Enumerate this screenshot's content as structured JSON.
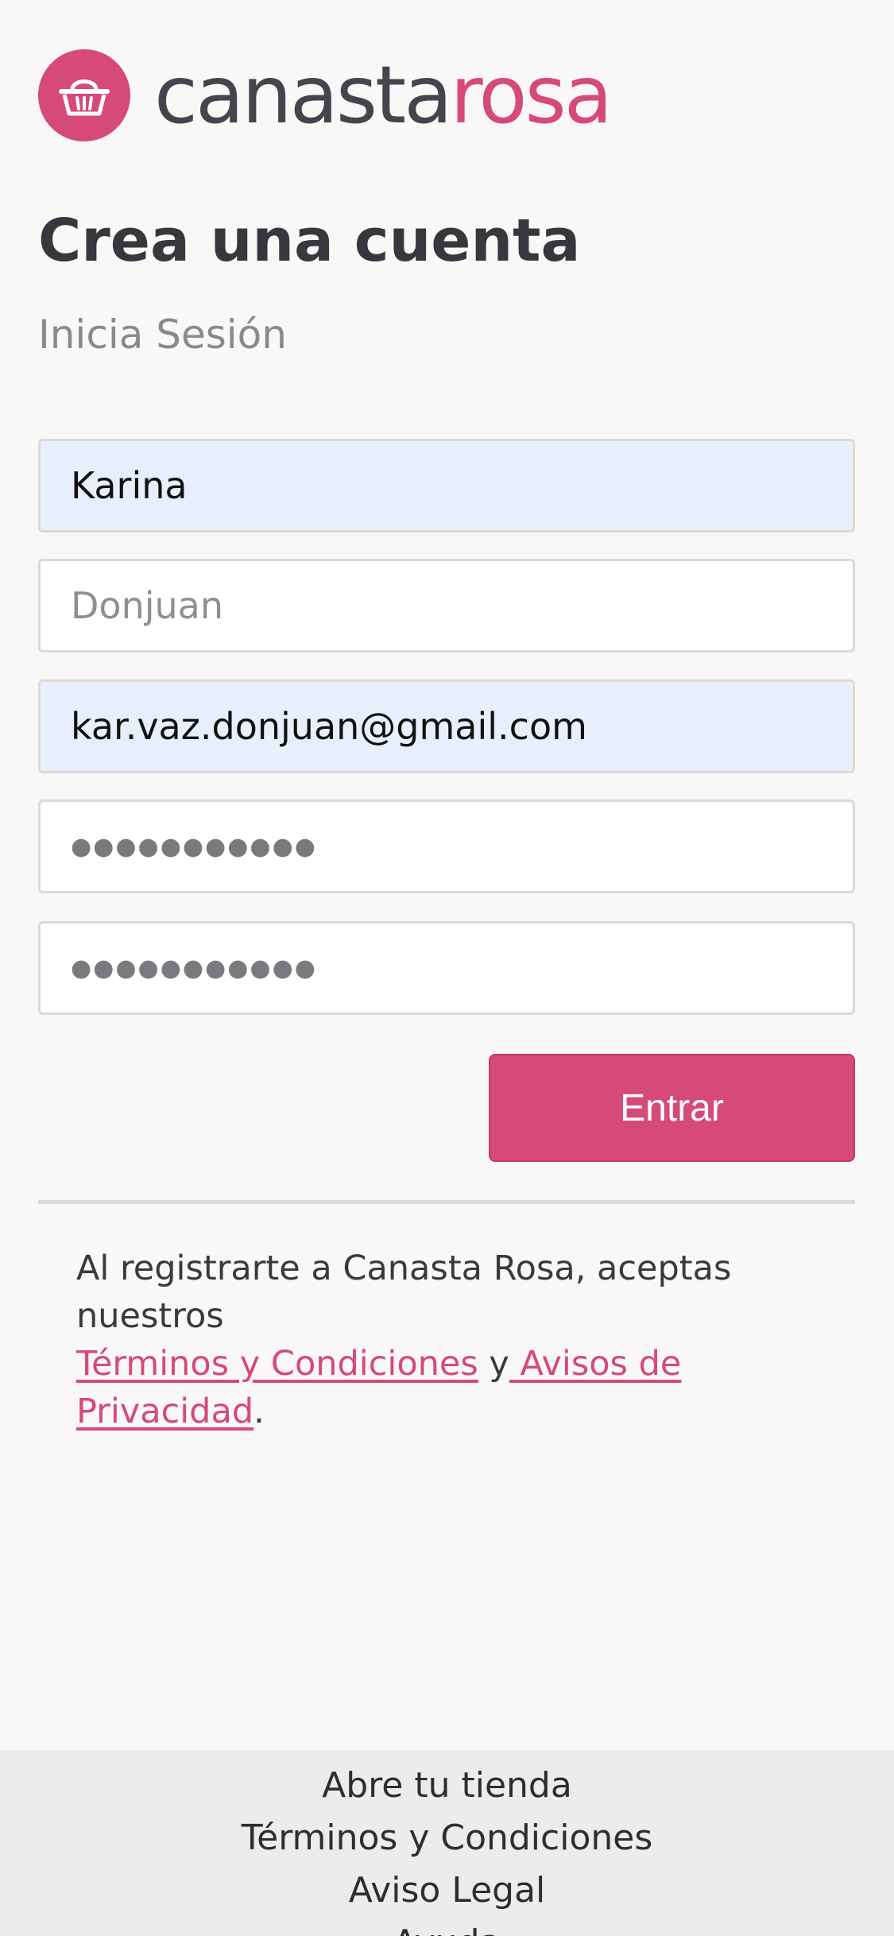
{
  "brand": {
    "name_part_a": "canasta",
    "name_part_b": "rosa",
    "logo_icon": "basket-icon",
    "accent_color": "#d64a78",
    "dark_color": "#46444d"
  },
  "page": {
    "title": "Crea una cuenta",
    "login_link": "Inicia Sesión"
  },
  "form": {
    "first_name": {
      "value": "Karina",
      "placeholder": ""
    },
    "last_name": {
      "value": "",
      "placeholder": "Donjuan"
    },
    "email": {
      "value": "kar.vaz.donjuan@gmail.com",
      "placeholder": ""
    },
    "password": {
      "masked": "●●●●●●●●●●●"
    },
    "password_confirm": {
      "masked": "●●●●●●●●●●●"
    },
    "submit_label": "Entrar"
  },
  "legal": {
    "prefix": "Al registrarte a Canasta Rosa, aceptas nuestros",
    "terms_link": "Términos y Condiciones",
    "connector": " y",
    "privacy_link": " Avisos de Privacidad",
    "suffix": "."
  },
  "footer": {
    "links": [
      "Abre tu tienda",
      "Términos y Condiciones",
      "Aviso Legal",
      "Ayuda"
    ]
  }
}
